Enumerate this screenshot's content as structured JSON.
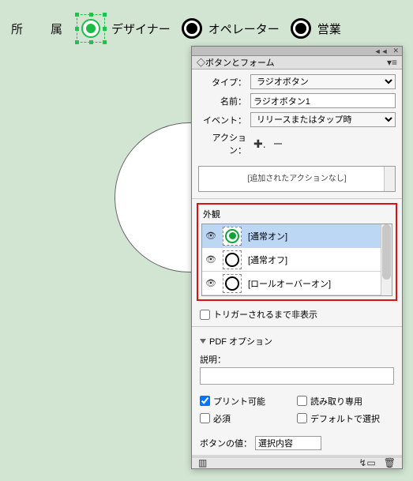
{
  "top": {
    "group_label": "所　属",
    "options": [
      "デザイナー",
      "オペレーター",
      "営業"
    ]
  },
  "panel": {
    "title": "◇ボタンとフォーム",
    "fields": {
      "type_label": "タイプ：",
      "type_value": "ラジオボタン",
      "name_label": "名前：",
      "name_value": "ラジオボタン1",
      "event_label": "イベント：",
      "event_value": "リリースまたはタップ時",
      "action_label": "アクション："
    },
    "action_empty": "[追加されたアクションなし]",
    "appearance": {
      "title": "外観",
      "states": [
        {
          "label": "[通常オン]",
          "selected": true,
          "filled": true
        },
        {
          "label": "[通常オフ]",
          "selected": false,
          "filled": false
        },
        {
          "label": "[ロールオーバーオン]",
          "selected": false,
          "filled": false
        }
      ]
    },
    "hide_until_trigger": "トリガーされるまで非表示",
    "pdf": {
      "header": "PDF オプション",
      "desc_label": "説明：",
      "printable": "プリント可能",
      "readonly": "読み取り専用",
      "required": "必須",
      "default_selected": "デフォルトで選択",
      "button_value_label": "ボタンの値：",
      "button_value": "選択内容"
    }
  }
}
